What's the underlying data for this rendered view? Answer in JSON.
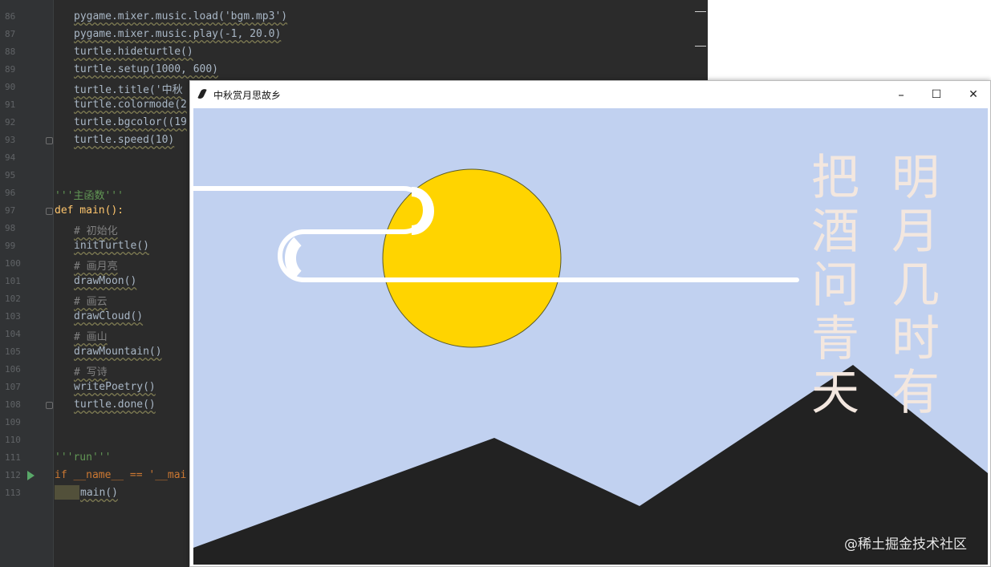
{
  "editor": {
    "lines": [
      {
        "num": "86",
        "code": "pygame.mixer.music.load('bgm.mp3')"
      },
      {
        "num": "87",
        "code": "pygame.mixer.music.play(-1, 20.0)"
      },
      {
        "num": "88",
        "code": "turtle.hideturtle()"
      },
      {
        "num": "89",
        "code": "turtle.setup(1000, 600)"
      },
      {
        "num": "90",
        "code": "turtle.title('中秋"
      },
      {
        "num": "91",
        "code": "turtle.colormode(2"
      },
      {
        "num": "92",
        "code": "turtle.bgcolor((19"
      },
      {
        "num": "93",
        "code": "turtle.speed(10)"
      },
      {
        "num": "94",
        "code": ""
      },
      {
        "num": "95",
        "code": ""
      },
      {
        "num": "96",
        "code": "'''主函数'''"
      },
      {
        "num": "97",
        "code": "def main():"
      },
      {
        "num": "98",
        "code": "# 初始化"
      },
      {
        "num": "99",
        "code": "initTurtle()"
      },
      {
        "num": "100",
        "code": "# 画月亮"
      },
      {
        "num": "101",
        "code": "drawMoon()"
      },
      {
        "num": "102",
        "code": "# 画云"
      },
      {
        "num": "103",
        "code": "drawCloud()"
      },
      {
        "num": "104",
        "code": "# 画山"
      },
      {
        "num": "105",
        "code": "drawMountain()"
      },
      {
        "num": "106",
        "code": "# 写诗"
      },
      {
        "num": "107",
        "code": "writePoetry()"
      },
      {
        "num": "108",
        "code": "turtle.done()"
      },
      {
        "num": "109",
        "code": ""
      },
      {
        "num": "110",
        "code": ""
      },
      {
        "num": "111",
        "code": "'''run'''"
      },
      {
        "num": "112",
        "code": "if __name__ == '__mai"
      },
      {
        "num": "113",
        "code": "main()"
      }
    ]
  },
  "window": {
    "title": "中秋赏月思故乡",
    "minimize": "–",
    "maximize": "☐",
    "close": "✕"
  },
  "poem": {
    "col_right": [
      "明",
      "月",
      "几",
      "时",
      "有"
    ],
    "col_left": [
      "把",
      "酒",
      "问",
      "青",
      "天"
    ]
  },
  "colors": {
    "sky": "#c1d1f0",
    "moon": "#ffd400",
    "mountain": "#222222",
    "cloud": "#ffffff",
    "poem_text": "#f3e7df"
  },
  "watermark": "@稀土掘金技术社区"
}
